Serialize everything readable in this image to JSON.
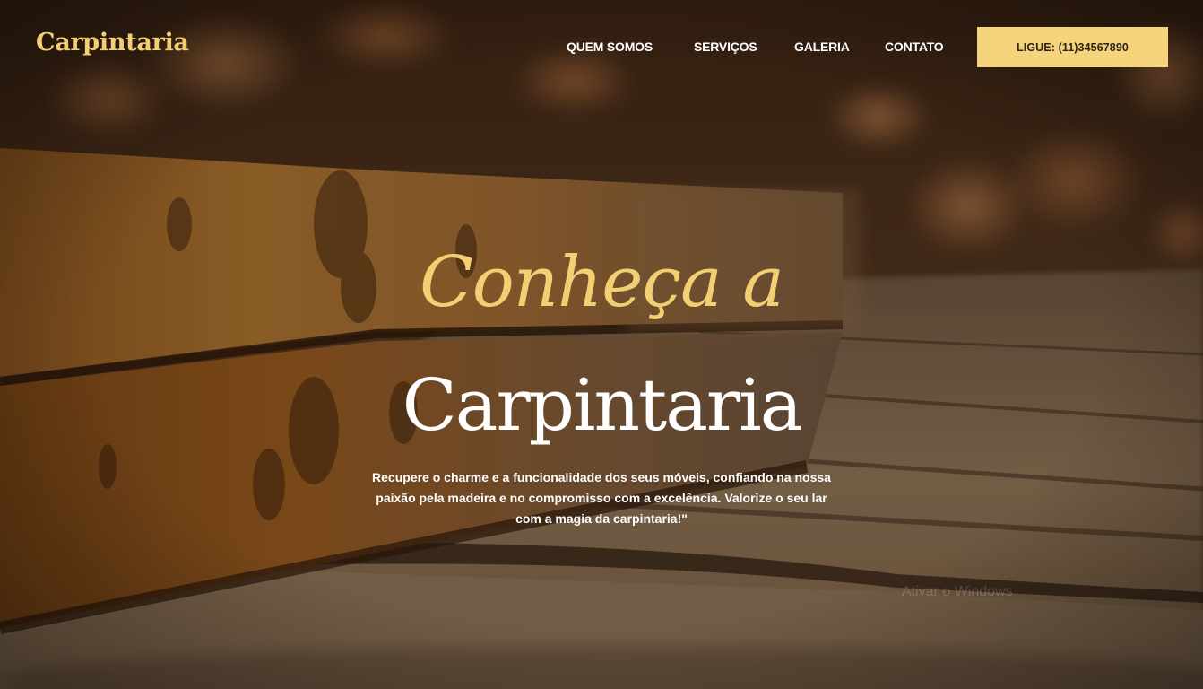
{
  "header": {
    "brand": "Carpintaria",
    "nav": [
      {
        "label": "QUEM SOMOS"
      },
      {
        "label": "SERVIÇOS"
      },
      {
        "label": "GALERIA"
      },
      {
        "label": "CONTATO"
      }
    ],
    "call_button": "LIGUE: (11)34567890"
  },
  "hero": {
    "kicker": "Conheça a",
    "title": "Carpintaria",
    "text": "Recupere o charme e a funcionalidade dos seus móveis, confiando na nossa paixão pela madeira e no compromisso com a excelência. Valorize o seu lar com a magia da carpintaria!\""
  },
  "overlay": {
    "watermark": "Ativar o Windows"
  },
  "colors": {
    "accent": "#f6d47c",
    "brand_text": "#f4ce72",
    "text_light": "#ffffff"
  }
}
